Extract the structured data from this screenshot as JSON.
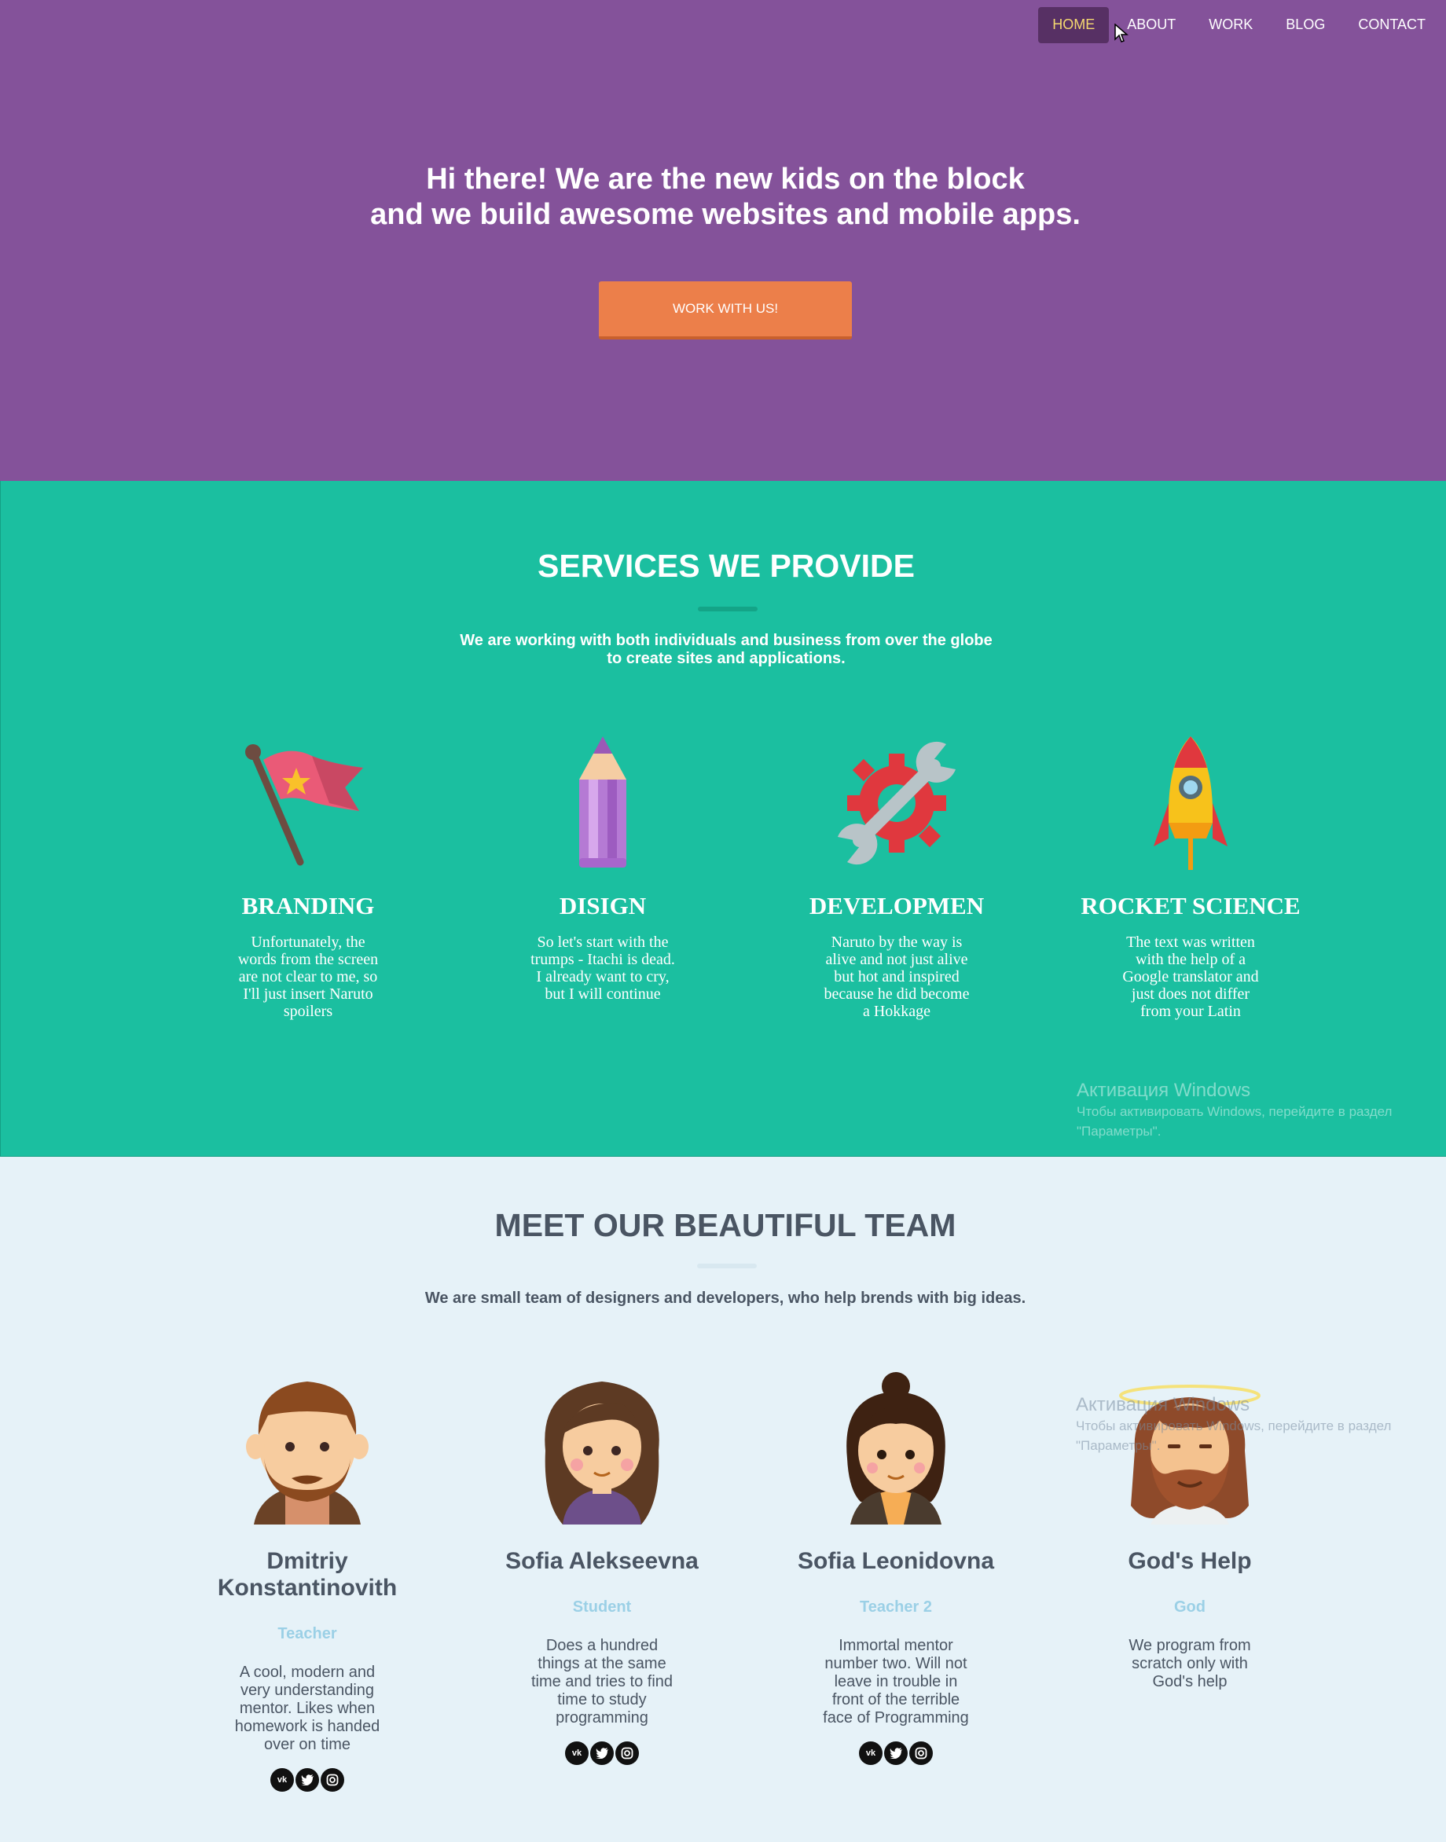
{
  "nav": {
    "items": [
      {
        "label": "HOME",
        "active": true
      },
      {
        "label": "ABOUT"
      },
      {
        "label": "WORK"
      },
      {
        "label": "BLOG"
      },
      {
        "label": "CONTACT"
      }
    ]
  },
  "hero": {
    "title_line1": "Hi there! We are the new kids on the block",
    "title_line2": "and we build awesome websites and mobile apps.",
    "cta_label": "WORK WITH US!"
  },
  "services": {
    "title": "SERVICES WE PROVIDE",
    "subtitle_line1": "We are working with both individuals and business from over the globe",
    "subtitle_line2": "to create sites and applications.",
    "items": [
      {
        "icon": "flag-icon",
        "title": "BRANDING",
        "text": "Unfortunately, the words from the screen are not clear to me, so I'll just insert Naruto spoilers"
      },
      {
        "icon": "pencil-icon",
        "title": "DISIGN",
        "text": "So let's start with the trumps - Itachi is dead. I already want to cry, but I will continue"
      },
      {
        "icon": "gear-wrench-icon",
        "title": "DEVELOPMEN",
        "text": "Naruto by the way is alive and not just alive but hot and inspired because he did become a Hokkage"
      },
      {
        "icon": "rocket-icon",
        "title": "ROCKET SCIENCE",
        "text": "The text was written with the help of a Google translator and just does not differ from your Latin"
      }
    ]
  },
  "team": {
    "title": "MEET OUR BEAUTIFUL TEAM",
    "subtitle": "We are small team of designers and developers, who help brends with big ideas.",
    "members": [
      {
        "name": "Dmitriy Konstantinovith",
        "role": "Teacher",
        "bio": "A cool, modern and very understanding mentor. Likes when homework is handed over on time",
        "socials": [
          "vk-icon",
          "twitter-icon",
          "instagram-icon"
        ]
      },
      {
        "name": "Sofia Alekseevna",
        "role": "Student",
        "bio": "Does a hundred things at the same time and tries to find time to study programming",
        "socials": [
          "vk-icon",
          "twitter-icon",
          "instagram-icon"
        ]
      },
      {
        "name": "Sofia Leonidovna",
        "role": "Teacher 2",
        "bio": "Immortal mentor number two. Will not leave in trouble in front of the terrible face of Programming",
        "socials": [
          "vk-icon",
          "twitter-icon",
          "instagram-icon"
        ]
      },
      {
        "name": "God's Help",
        "role": "God",
        "bio": "We program from scratch only with God's help",
        "socials": []
      }
    ]
  },
  "watermark": {
    "line1": "Активация Windows",
    "line2": "Чтобы активировать Windows, перейдите в раздел \"Параметры\"."
  },
  "colors": {
    "hero_bg": "#84529a",
    "services_bg": "#1bbfa0",
    "team_bg": "#e6f2f8",
    "cta": "#ec7f4a",
    "nav_active_text": "#f5d970",
    "role_text": "#9bd0e6"
  }
}
